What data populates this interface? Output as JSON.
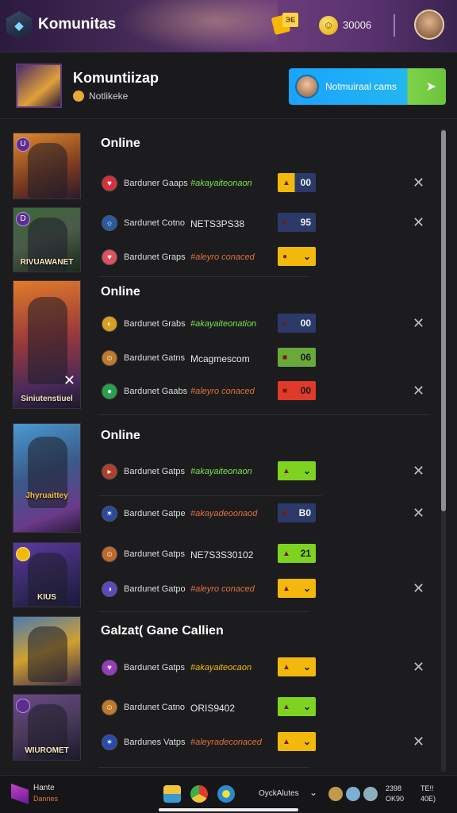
{
  "header": {
    "title": "Komunitas",
    "notif_badge": "ЭE",
    "coins": "30006"
  },
  "group": {
    "name": "Komuntiizap",
    "subtitle": "Notlikeke",
    "cta_label": "Notmuiraal cams"
  },
  "sections": [
    {
      "title": "Online"
    },
    {
      "title": "Online"
    },
    {
      "title": "Online"
    },
    {
      "title": "Galzat( Gane Callien"
    }
  ],
  "cards": [
    {
      "badge": "U",
      "caption": ""
    },
    {
      "badge": "D",
      "caption": "RIVUAWANET"
    },
    {
      "badge": "",
      "caption": "Siniutenstiuel"
    },
    {
      "badge": "",
      "caption": "Jhyruaittey"
    },
    {
      "badge": "",
      "caption": "KIUS"
    },
    {
      "badge": "",
      "caption": ""
    },
    {
      "badge": "",
      "caption": "WIUROMET"
    }
  ],
  "rows": [
    {
      "name": "Barduner Gaaps",
      "status": "#akayaiteonaon",
      "status_color": "#7be24a",
      "pill_text": "00",
      "pill_icon": "▲",
      "pill_bg": "#f2b90c",
      "pill_bg2": "#2c3a6a",
      "icon_bg": "#d8303a",
      "icon": "♥",
      "has_close": true
    },
    {
      "name": "Sardunet Cotno",
      "status": "NETS3PS38",
      "status_color": "#e6e6e6",
      "pill_text": "95",
      "pill_icon": "●",
      "pill_bg": "#2c3a6a",
      "pill_bg2": "#2c3a6a",
      "icon_bg": "#2a5aa0",
      "icon": "☼",
      "has_close": true
    },
    {
      "name": "Bardunet Graps",
      "status": "#aleyro conaced",
      "status_color": "#e0703a",
      "pill_text": "⌄",
      "pill_icon": "●",
      "pill_bg": "#f2b90c",
      "pill_bg2": "#f2b90c",
      "icon_bg": "#e05060",
      "icon": "♥",
      "has_close": false
    },
    {
      "name": "Bardunet Grabs",
      "status": "#akayaiteonation",
      "status_color": "#7be24a",
      "pill_text": "00",
      "pill_icon": "●",
      "pill_bg": "#2c3a6a",
      "pill_bg2": "#2c3a6a",
      "icon_bg": "#d9a020",
      "icon": "◐",
      "has_close": true
    },
    {
      "name": "Bardunet Gatns",
      "status": "Mcagmescom",
      "status_color": "#e6e6e6",
      "pill_text": "06",
      "pill_icon": "■",
      "pill_bg": "#6aa83a",
      "pill_bg2": "#6aa83a",
      "icon_bg": "#c07a2a",
      "icon": "☺",
      "has_close": false
    },
    {
      "name": "Bardunet Gaabs",
      "status": "#aleyro conaced",
      "status_color": "#e0703a",
      "pill_text": "00",
      "pill_icon": "■",
      "pill_bg": "#e03a2a",
      "pill_bg2": "#e03a2a",
      "icon_bg": "#2aa04a",
      "icon": "●",
      "has_close": true
    },
    {
      "name": "Bardunet Gatps",
      "status": "#akayaiteonaon",
      "status_color": "#7be24a",
      "pill_text": "⌄",
      "pill_icon": "▲",
      "pill_bg": "#7ed321",
      "pill_bg2": "#7ed321",
      "icon_bg": "#b0402a",
      "icon": "▸",
      "has_close": true
    },
    {
      "name": "Bardunet Gatpe",
      "status": "#akayadeoonaod",
      "status_color": "#e0703a",
      "pill_text": "B0",
      "pill_icon": "■",
      "pill_bg": "#2c3a6a",
      "pill_bg2": "#2c3a6a",
      "icon_bg": "#2a4aa0",
      "icon": "✶",
      "has_close": true
    },
    {
      "name": "Bardunet Gatps",
      "status": "NE7S3S30102",
      "status_color": "#e6e6e6",
      "pill_text": "21",
      "pill_icon": "▲",
      "pill_bg": "#7ed321",
      "pill_bg2": "#7ed321",
      "icon_bg": "#c06a2a",
      "icon": "☺",
      "has_close": false
    },
    {
      "name": "Bardunet Gatpo",
      "status": "#aleyro conaced",
      "status_color": "#e0703a",
      "pill_text": "⌄",
      "pill_icon": "▲",
      "pill_bg": "#f2b90c",
      "pill_bg2": "#f2b90c",
      "icon_bg": "#5a4ac0",
      "icon": "◑",
      "has_close": true
    },
    {
      "name": "Bardunet Gatps",
      "status": "#akayaiteocaon",
      "status_color": "#f2b90c",
      "pill_text": "⌄",
      "pill_icon": "▲",
      "pill_bg": "#f2b90c",
      "pill_bg2": "#f2b90c",
      "icon_bg": "#9a3ac0",
      "icon": "♥",
      "has_close": true
    },
    {
      "name": "Bardunet Catno",
      "status": "ORIS9402",
      "status_color": "#e6e6e6",
      "pill_text": "⌄",
      "pill_icon": "▲",
      "pill_bg": "#7ed321",
      "pill_bg2": "#7ed321",
      "icon_bg": "#c07a2a",
      "icon": "☺",
      "has_close": false
    },
    {
      "name": "Bardunes Vatps",
      "status": "#aleyradeconaced",
      "status_color": "#e0703a",
      "pill_text": "⌄",
      "pill_icon": "▲",
      "pill_bg": "#f2b90c",
      "pill_bg2": "#f2b90c",
      "icon_bg": "#2a4ab0",
      "icon": "✶",
      "has_close": true
    }
  ],
  "taskbar": {
    "title": "Hante",
    "subtitle": "Dannes",
    "status": "OyckAlutes",
    "time": "2398\nOK90",
    "date": "TE!!\n40E)"
  }
}
